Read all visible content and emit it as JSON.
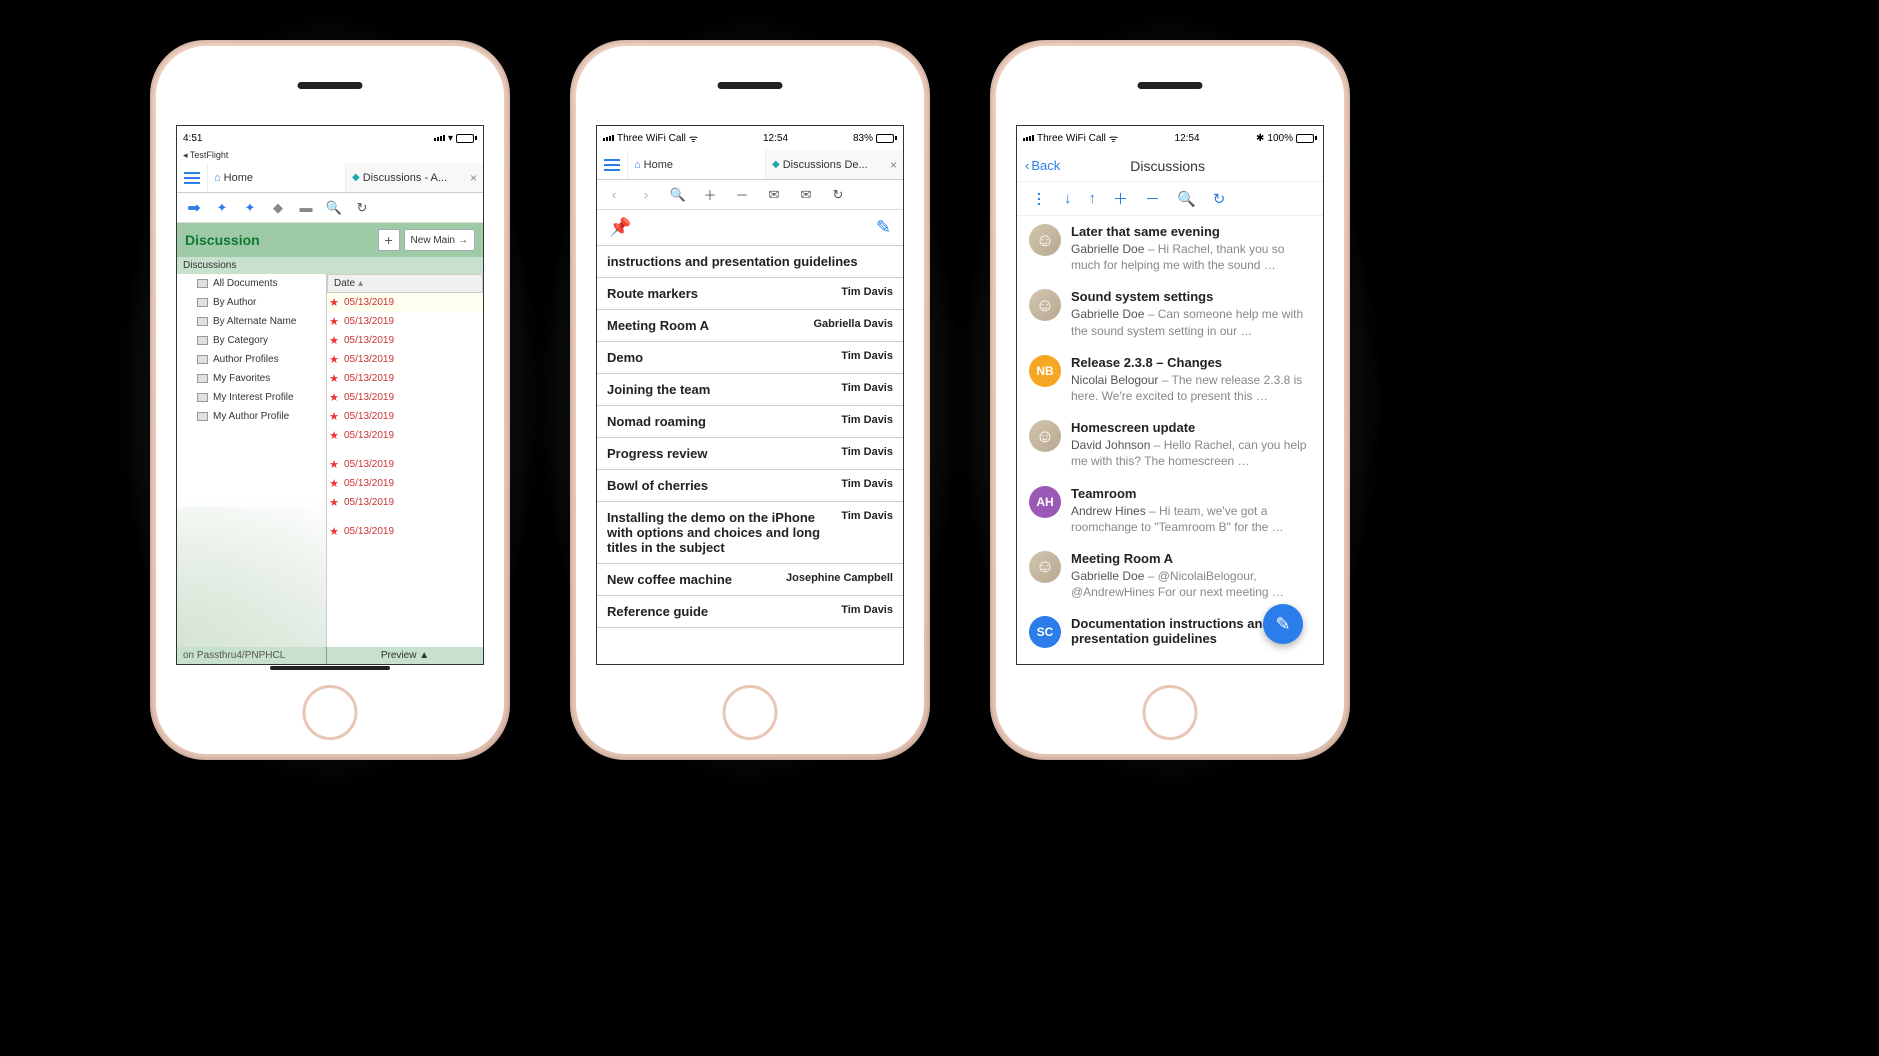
{
  "phone1": {
    "status": {
      "time": "4:51",
      "back": "◂ TestFlight"
    },
    "tabs": {
      "home": "Home",
      "active": "Discussions - A..."
    },
    "header": {
      "title": "Discussion",
      "newMain": "New Main"
    },
    "subheader": "Discussions",
    "dateHeader": "Date",
    "nav": [
      "All Documents",
      "By Author",
      "By Alternate Name",
      "By Category",
      "Author Profiles",
      "My Favorites",
      "My Interest Profile",
      "My Author Profile"
    ],
    "dates": [
      "05/13/2019",
      "05/13/2019",
      "05/13/2019",
      "05/13/2019",
      "05/13/2019",
      "05/13/2019",
      "05/13/2019",
      "05/13/2019",
      "05/13/2019",
      "05/13/2019",
      "05/13/2019",
      "05/13/2019"
    ],
    "footer": {
      "left": "on Passthru4/PNPHCL",
      "right": "Preview ▲"
    }
  },
  "phone2": {
    "status": {
      "carrier": "Three WiFi Call",
      "time": "12:54",
      "battery": "83%"
    },
    "tabs": {
      "home": "Home",
      "active": "Discussions De..."
    },
    "items": [
      {
        "title": "instructions and presentation guidelines",
        "author": ""
      },
      {
        "title": "Route markers",
        "author": "Tim Davis"
      },
      {
        "title": "Meeting Room A",
        "author": "Gabriella Davis"
      },
      {
        "title": "Demo",
        "author": "Tim Davis"
      },
      {
        "title": "Joining the team",
        "author": "Tim Davis"
      },
      {
        "title": "Nomad roaming",
        "author": "Tim Davis"
      },
      {
        "title": "Progress review",
        "author": "Tim Davis"
      },
      {
        "title": "Bowl of cherries",
        "author": "Tim Davis"
      },
      {
        "title": "Installing the demo on the iPhone with options and choices and long titles in the subject",
        "author": "Tim Davis"
      },
      {
        "title": "New coffee machine",
        "author": "Josephine Campbell"
      },
      {
        "title": "Reference guide",
        "author": "Tim Davis"
      }
    ]
  },
  "phone3": {
    "status": {
      "carrier": "Three WiFi Call",
      "time": "12:54",
      "battery": "100%"
    },
    "nav": {
      "back": "Back",
      "title": "Discussions"
    },
    "items": [
      {
        "avatar": "photo",
        "initials": "",
        "title": "Later that same evening",
        "author": "Gabrielle Doe",
        "text": " – Hi Rachel, thank you so much for helping me with the sound …"
      },
      {
        "avatar": "photo",
        "initials": "",
        "title": "Sound system settings",
        "author": "Gabrielle Doe",
        "text": " – Can someone help me with the sound system setting in our …"
      },
      {
        "avatar": "nb",
        "initials": "NB",
        "title": "Release 2.3.8 – Changes",
        "author": "Nicolai Belogour",
        "text": " – The new release 2.3.8 is here. We're excited to present this …"
      },
      {
        "avatar": "photo",
        "initials": "",
        "title": "Homescreen update",
        "author": "David Johnson",
        "text": " – Hello Rachel, can you help me with this? The homescreen …"
      },
      {
        "avatar": "ah",
        "initials": "AH",
        "title": "Teamroom",
        "author": "Andrew Hines",
        "text": " – Hi team, we've got a roomchange to \"Teamroom B\" for the …"
      },
      {
        "avatar": "photo",
        "initials": "",
        "title": "Meeting Room A",
        "author": "Gabrielle Doe",
        "text": " – @NicolaiBelogour, @AndrewHines For our next meeting …"
      },
      {
        "avatar": "sc",
        "initials": "SC",
        "title": "Documentation instructions and presentation guidelines",
        "author": "",
        "text": ""
      }
    ]
  }
}
